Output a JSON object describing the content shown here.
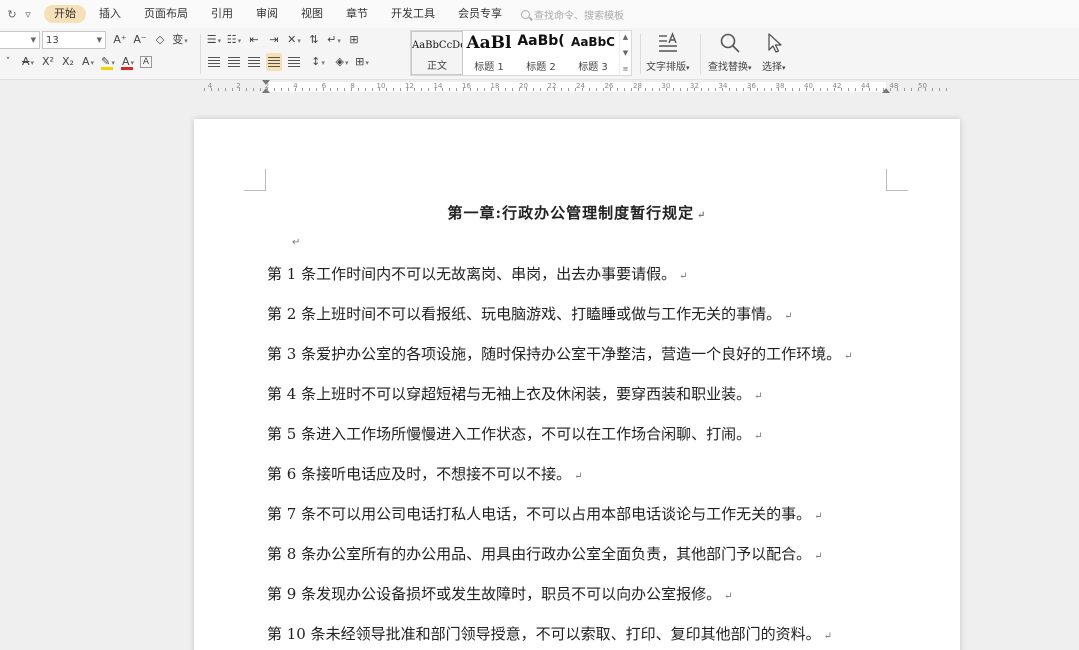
{
  "menu": {
    "undo_icon": "undo-icon",
    "more_icon": "quick-access-dropdown-icon",
    "tabs": [
      {
        "label": "开始",
        "active": true
      },
      {
        "label": "插入"
      },
      {
        "label": "页面布局"
      },
      {
        "label": "引用"
      },
      {
        "label": "审阅"
      },
      {
        "label": "视图"
      },
      {
        "label": "章节"
      },
      {
        "label": "开发工具"
      },
      {
        "label": "会员专享"
      }
    ],
    "search_placeholder": "查找命令、搜索模板"
  },
  "ribbon": {
    "font_name": "",
    "font_size": "13",
    "styles": [
      {
        "preview": "AaBbCcDd",
        "label": "正文"
      },
      {
        "preview": "AaBl",
        "label": "标题 1"
      },
      {
        "preview": "AaBb(",
        "label": "标题 2"
      },
      {
        "preview": "AaBbC",
        "label": "标题 3"
      }
    ],
    "text_layout_label": "文字排版",
    "find_replace_label": "查找替换",
    "select_label": "选择",
    "font_buttons": [
      "A⁺",
      "A⁻",
      "◇",
      "变"
    ],
    "format_buttons": [
      "A",
      "X²",
      "X₂",
      "A",
      "A",
      "A"
    ]
  },
  "ruler": {
    "labels": [
      "4",
      "2",
      "2",
      "4",
      "6",
      "8",
      "10",
      "12",
      "14",
      "16",
      "18",
      "20",
      "22",
      "24",
      "26",
      "28",
      "30",
      "32",
      "34",
      "36",
      "38",
      "40",
      "42",
      "44",
      "48",
      "50"
    ]
  },
  "document": {
    "title": "第一章:行政办公管理制度暂行规定",
    "paragraph_mark": "↵",
    "paragraphs": [
      "第 1 条工作时间内不可以无故离岗、串岗，出去办事要请假。",
      "第 2 条上班时间不可以看报纸、玩电脑游戏、打瞌睡或做与工作无关的事情。",
      "第 3 条爱护办公室的各项设施，随时保持办公室干净整洁，营造一个良好的工作环境。",
      "第 4 条上班时不可以穿超短裙与无袖上衣及休闲装，要穿西装和职业装。",
      "第 5 条进入工作场所慢慢进入工作状态，不可以在工作场合闲聊、打闹。",
      "第 6 条接听电话应及时，不想接不可以不接。",
      "第 7 条不可以用公司电话打私人电话，不可以占用本部电话谈论与工作无关的事。",
      "第 8 条办公室所有的办公用品、用具由行政办公室全面负责，其他部门予以配合。",
      "第 9 条发现办公设备损坏或发生故障时，职员不可以向办公室报修。",
      "第 10 条未经领导批准和部门领导授意，不可以索取、打印、复印其他部门的资料。"
    ]
  },
  "colors": {
    "active_tab": "#f7e0b8",
    "highlight_bar": "#f2d500",
    "font_color_bar": "#d62828",
    "margin_icon": "#6d8fc0"
  }
}
